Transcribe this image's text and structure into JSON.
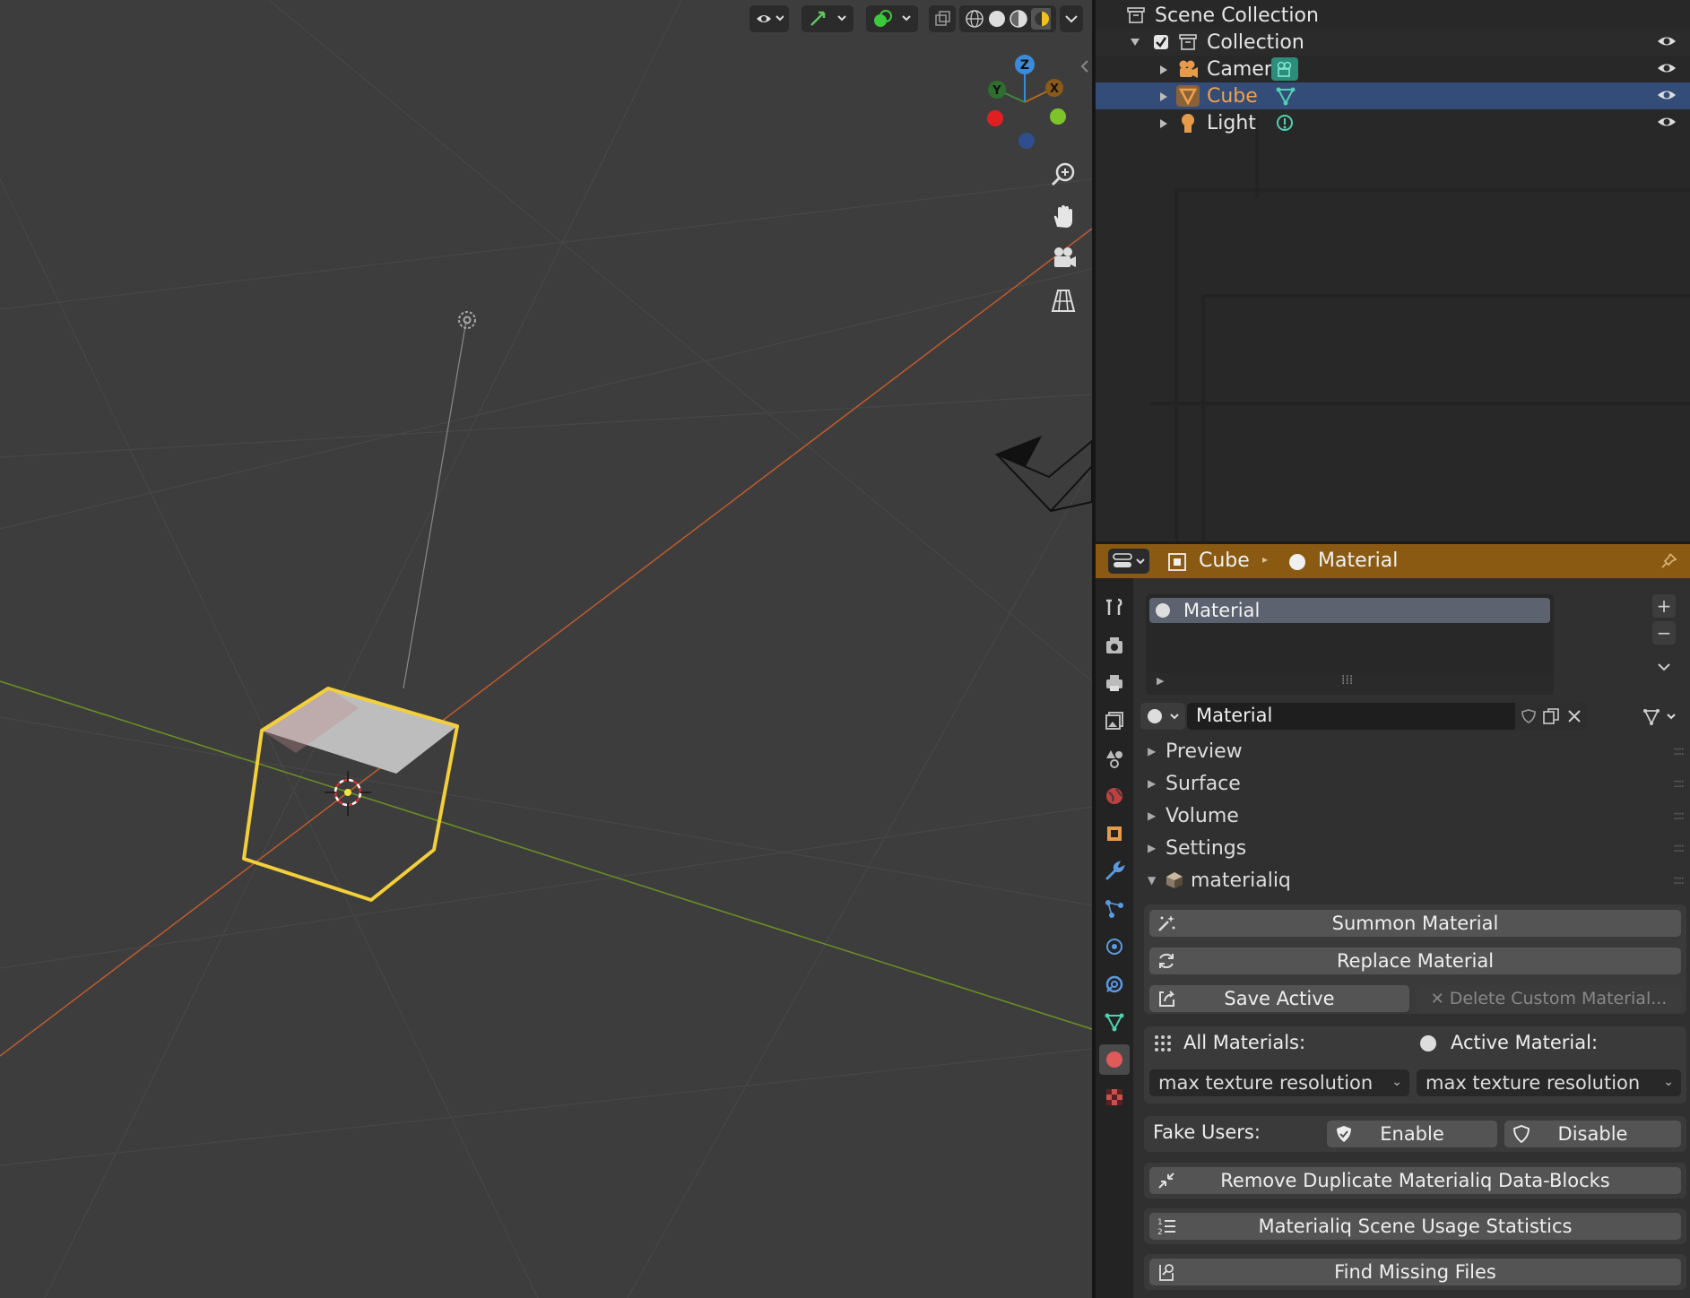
{
  "outliner": {
    "scene_collection": "Scene Collection",
    "collection": "Collection",
    "items": [
      {
        "label": "Camera"
      },
      {
        "label": "Cube"
      },
      {
        "label": "Light"
      }
    ]
  },
  "properties": {
    "breadcrumb": {
      "object": "Cube",
      "data": "Material"
    },
    "slot_label": "Material",
    "material_name": "Material",
    "sections": {
      "preview": "Preview",
      "surface": "Surface",
      "volume": "Volume",
      "settings": "Settings",
      "addon": "materialiq"
    },
    "buttons": {
      "summon": "Summon Material",
      "replace": "Replace Material",
      "save_active": "Save Active",
      "delete_custom": "Delete Custom Material..."
    },
    "all_materials_label": "All Materials:",
    "active_material_label": "Active Material:",
    "all_resolution": "max texture resolution",
    "active_resolution": "max texture resolution",
    "fake_users_label": "Fake Users:",
    "enable": "Enable",
    "disable": "Disable",
    "remove_duplicates": "Remove Duplicate Materialiq Data-Blocks",
    "usage_stats": "Materialiq Scene Usage Statistics",
    "find_missing": "Find Missing Files"
  },
  "colors": {
    "selection_outline": "#ffd43b",
    "header_orange": "#8a5a12",
    "outliner_selected": "#334c78",
    "x_axis": "#c2552c",
    "y_axis": "#6a8e23"
  }
}
